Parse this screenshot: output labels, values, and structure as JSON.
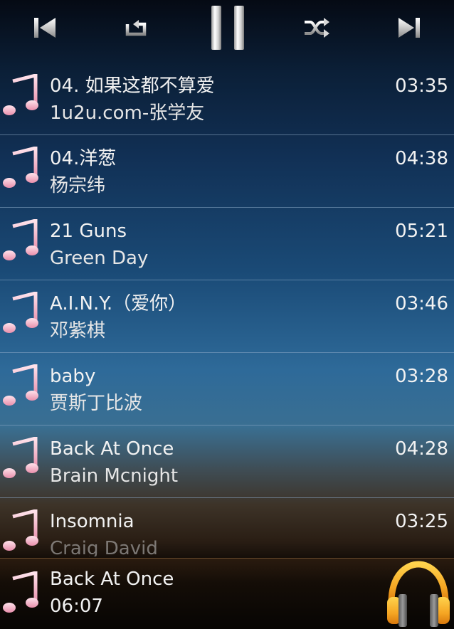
{
  "controls": {
    "previous": "previous-icon",
    "repeat": "repeat-icon",
    "pause": "pause-icon",
    "shuffle": "shuffle-icon",
    "next": "next-icon"
  },
  "songs": [
    {
      "title": "04. 如果这都不算爱",
      "artist": "1u2u.com-张学友",
      "duration": "03:35"
    },
    {
      "title": "04.洋葱",
      "artist": "杨宗纬",
      "duration": "04:38"
    },
    {
      "title": "21 Guns",
      "artist": "Green Day",
      "duration": "05:21"
    },
    {
      "title": "A.I.N.Y.（爱你）",
      "artist": "邓紫棋",
      "duration": "03:46"
    },
    {
      "title": "baby",
      "artist": "贾斯丁比波",
      "duration": "03:28"
    },
    {
      "title": "Back At Once",
      "artist": "Brain Mcnight",
      "duration": "04:28"
    },
    {
      "title": "Insomnia",
      "artist": "Craig David",
      "duration": "03:25"
    }
  ],
  "now_playing": {
    "title": "Back At Once",
    "time": "06:07",
    "app_icon": "headphones-icon"
  },
  "colors": {
    "note_icon": "#f4b6c8",
    "headphones": "#f5a623"
  }
}
